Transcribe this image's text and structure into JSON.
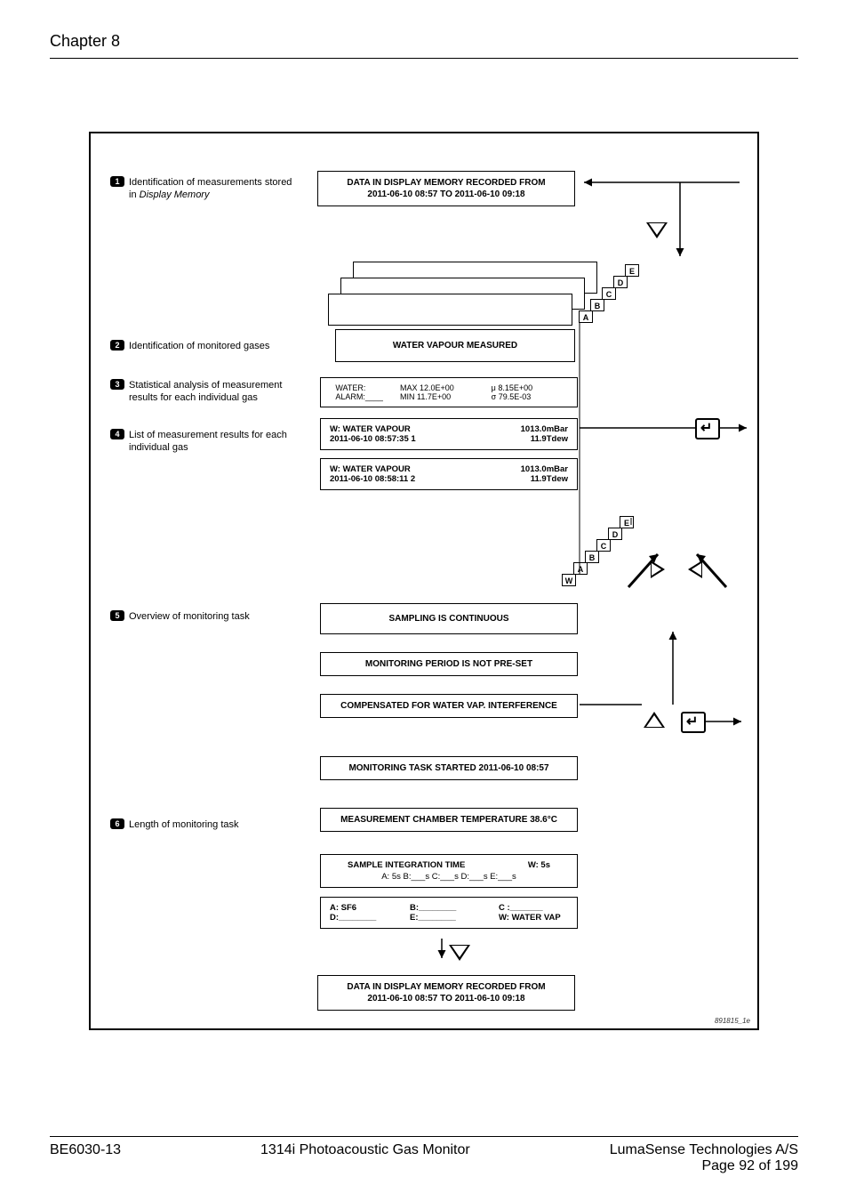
{
  "header": {
    "chapter": "Chapter 8"
  },
  "footer": {
    "left": "BE6030-13",
    "center": "1314i Photoacoustic Gas Monitor",
    "right": "LumaSense Technologies A/S",
    "page": "Page 92 of 199"
  },
  "annotations": {
    "a1": {
      "n": "1",
      "text_a": "Identification of measurements stored in ",
      "text_b": "Display Memory"
    },
    "a2": {
      "n": "2",
      "text": "Identification of monitored gases"
    },
    "a3": {
      "n": "3",
      "text": "Statistical analysis of measurement results for each individual gas"
    },
    "a4": {
      "n": "4",
      "text": "List of measurement results for each individual gas"
    },
    "a5": {
      "n": "5",
      "text": "Overview of monitoring task"
    },
    "a6": {
      "n": "6",
      "text": "Length of monitoring task"
    }
  },
  "boxes": {
    "top": {
      "l1": "DATA IN DISPLAY MEMORY RECORDED FROM",
      "l2": "2011-06-10  08:57  TO  2011-06-10  09:18"
    },
    "gas_header": "WATER VAPOUR MEASURED",
    "stats": {
      "c1a": "WATER:",
      "c1b": "ALARM:____",
      "c2a": "MAX 12.0E+00",
      "c2b": "MIN 11.7E+00",
      "c3a": "μ 8.15E+00",
      "c3b": "σ 79.5E-03"
    },
    "meas1": {
      "l1a": "W:  WATER VAPOUR",
      "l1b": "1013.0mBar",
      "l2a": "2011-06-10    08:57:35     1",
      "l2b": "11.9Tdew"
    },
    "meas2": {
      "l1a": "W:  WATER VAPOUR",
      "l1b": "1013.0mBar",
      "l2a": "2011-06-10    08:58:11     2",
      "l2b": "11.9Tdew"
    },
    "ov1": "SAMPLING IS CONTINUOUS",
    "ov2": "MONITORING PERIOD IS NOT PRE-SET",
    "ov3": "COMPENSATED FOR WATER VAP. INTERFERENCE",
    "ov4": "MONITORING TASK STARTED 2011-06-10   08:57",
    "ov5": "MEASUREMENT CHAMBER TEMPERATURE 38.6°C",
    "sit": {
      "l1a": "SAMPLE INTEGRATION TIME",
      "l1b": "W:  5s",
      "l2": "A: 5s    B:___s    C:___s    D:___s    E:___s"
    },
    "assign": {
      "a": "A: SF6",
      "b": "B:________",
      "c": "C :_______",
      "d": "D:________",
      "e": "E:________",
      "w": "W: WATER VAP"
    },
    "bottom": {
      "l1": "DATA IN DISPLAY MEMORY RECORDED FROM",
      "l2": "2011-06-10  08:57  TO  2011-06-10  09:18"
    }
  },
  "tabs": {
    "set1": [
      "A",
      "B",
      "C",
      "D",
      "E"
    ],
    "set2": [
      "W",
      "A",
      "B",
      "C",
      "D",
      "E"
    ]
  },
  "figure_id": "891815_1e"
}
